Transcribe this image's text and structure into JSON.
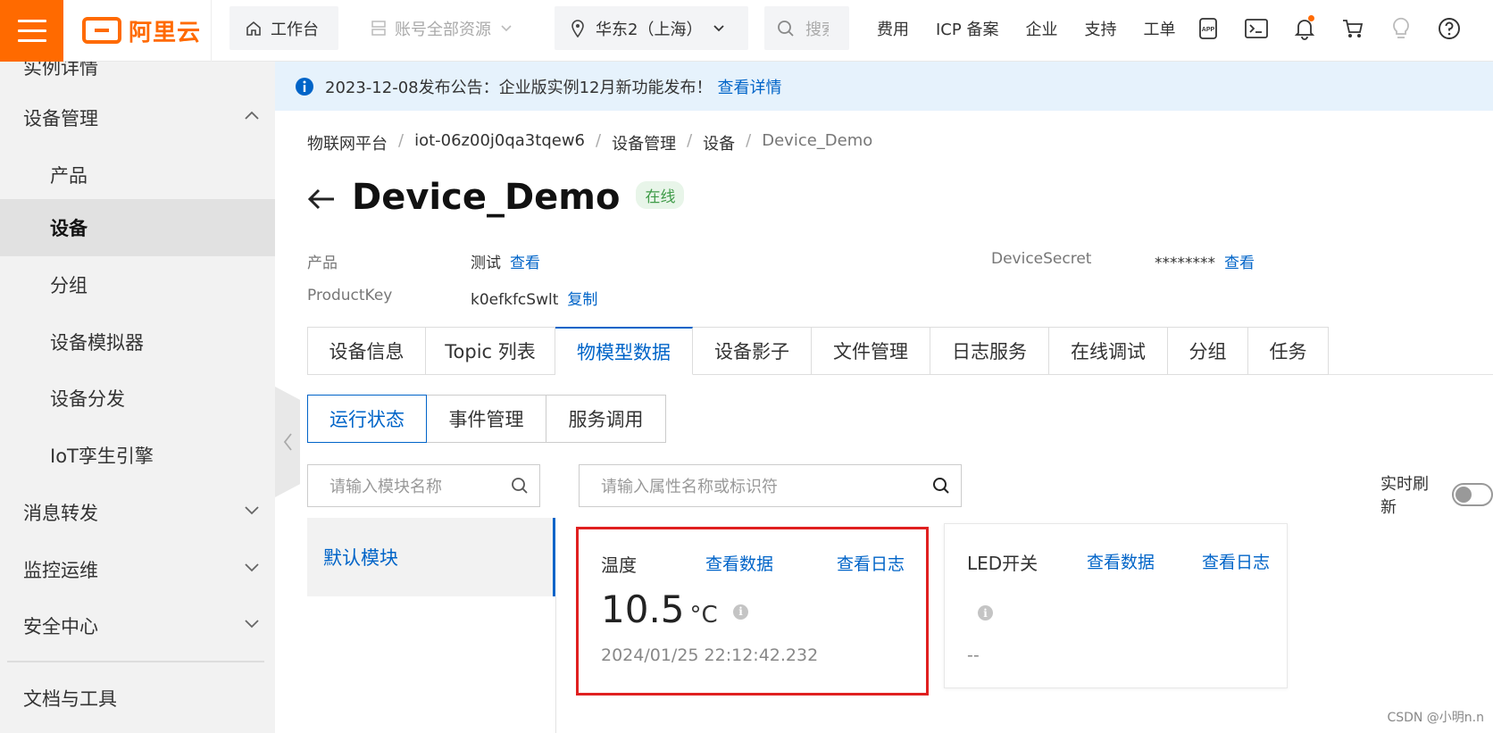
{
  "topbar": {
    "brand": "阿里云",
    "workbench": "工作台",
    "account": "账号全部资源",
    "region": "华东2（上海）",
    "search_placeholder": "搜索",
    "links": [
      "费用",
      "ICP 备案",
      "企业",
      "支持",
      "工单"
    ],
    "colors": {
      "brand": "#ff6a00",
      "link": "#0064c8",
      "highlight": "#e02020"
    }
  },
  "sidebar": {
    "items": [
      {
        "label": "实例详情"
      },
      {
        "label": "设备管理"
      },
      {
        "label": "产品"
      },
      {
        "label": "设备"
      },
      {
        "label": "分组"
      },
      {
        "label": "设备模拟器"
      },
      {
        "label": "设备分发"
      },
      {
        "label": "IoT孪生引擎"
      },
      {
        "label": "消息转发"
      },
      {
        "label": "监控运维"
      },
      {
        "label": "安全中心"
      },
      {
        "label": "文档与工具"
      }
    ]
  },
  "notice": {
    "text": "2023-12-08发布公告：企业版实例12月新功能发布！",
    "link": "查看详情"
  },
  "breadcrumb": [
    "物联网平台",
    "iot-06z00j0qa3tqew6",
    "设备管理",
    "设备",
    "Device_Demo"
  ],
  "device": {
    "name": "Device_Demo",
    "status": "在线",
    "product_label": "产品",
    "product_value": "测试",
    "product_link": "查看",
    "productkey_label": "ProductKey",
    "productkey_value": "k0efkfcSwlt",
    "productkey_link": "复制",
    "secret_label": "DeviceSecret",
    "secret_value": "********",
    "secret_link": "查看"
  },
  "tabs": [
    "设备信息",
    "Topic 列表",
    "物模型数据",
    "设备影子",
    "文件管理",
    "日志服务",
    "在线调试",
    "分组",
    "任务"
  ],
  "subtabs": [
    "运行状态",
    "事件管理",
    "服务调用"
  ],
  "module_search_placeholder": "请输入模块名称",
  "property_search_placeholder": "请输入属性名称或标识符",
  "realtime_label": "实时刷新",
  "realtime_on": false,
  "modules": [
    "默认模块"
  ],
  "properties": [
    {
      "name": "温度",
      "link_data": "查看数据",
      "link_log": "查看日志",
      "value": "10.5",
      "unit": "°C",
      "time": "2024/01/25 22:12:42.232"
    },
    {
      "name": "LED开关",
      "link_data": "查看数据",
      "link_log": "查看日志",
      "value": "",
      "unit": "",
      "time": "--"
    }
  ],
  "watermark": "CSDN @小明n.n"
}
